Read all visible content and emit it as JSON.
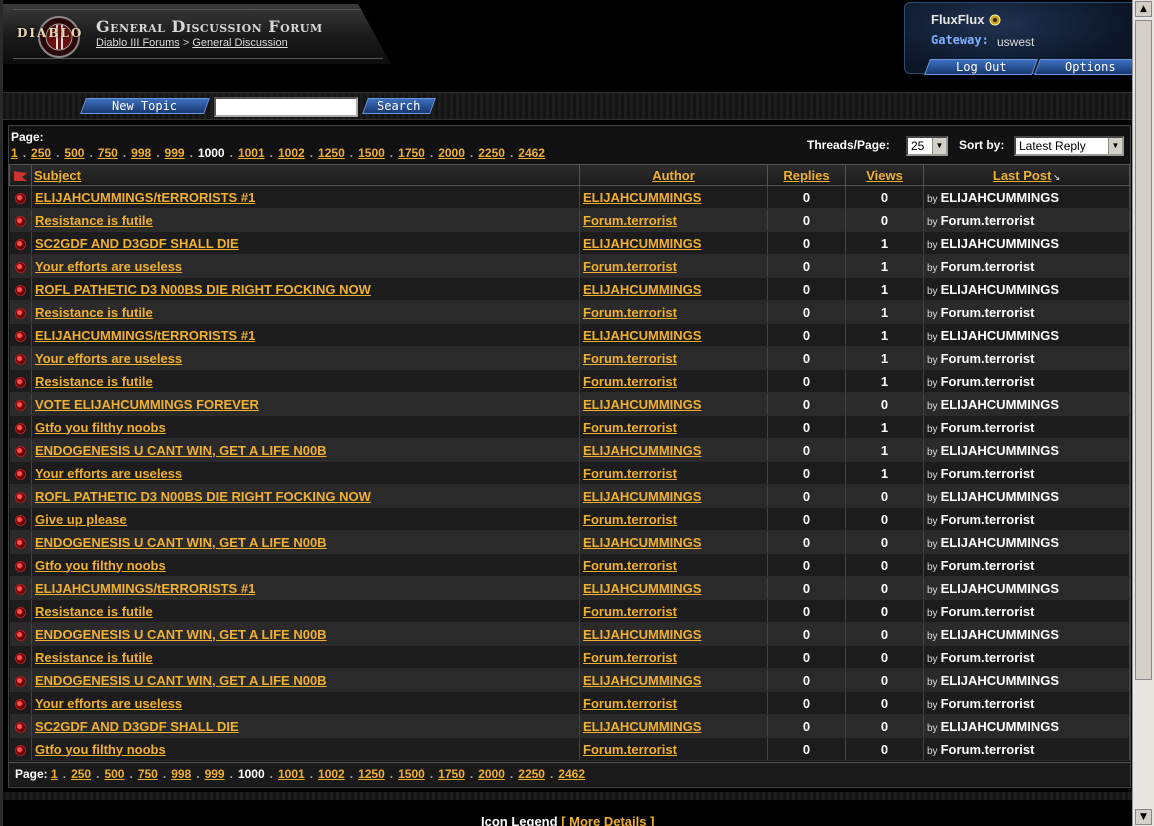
{
  "header": {
    "logo_text": "DIABLO",
    "forum_title": "General Discussion Forum",
    "breadcrumb": {
      "parent": "Diablo III Forums",
      "separator": ">",
      "current": "General Discussion"
    }
  },
  "user": {
    "name": "FluxFlux",
    "gateway_label": "Gateway:",
    "gateway_value": "uswest",
    "logout_label": "Log Out",
    "options_label": "Options"
  },
  "toolbar": {
    "new_topic_label": "New Topic",
    "search_value": "",
    "search_label": "Search"
  },
  "pagination": {
    "label": "Page:",
    "pages": [
      "1",
      "250",
      "500",
      "750",
      "998",
      "999",
      "1000",
      "1001",
      "1002",
      "1250",
      "1500",
      "1750",
      "2000",
      "2250",
      "2462"
    ],
    "current": "1000"
  },
  "controls": {
    "threads_per_page_label": "Threads/Page:",
    "threads_per_page_value": "25",
    "sort_by_label": "Sort by:",
    "sort_by_value": "Latest Reply"
  },
  "table": {
    "columns": {
      "subject": "Subject",
      "author": "Author",
      "replies": "Replies",
      "views": "Views",
      "last_post": "Last Post"
    },
    "by_label": "by",
    "rows": [
      {
        "subject": "ELIJAHCUMMINGS/tERRORISTS #1",
        "author": "ELIJAHCUMMINGS",
        "replies": "0",
        "views": "0",
        "last_by": "ELIJAHCUMMINGS"
      },
      {
        "subject": "Resistance is futile",
        "author": "Forum.terrorist",
        "replies": "0",
        "views": "0",
        "last_by": "Forum.terrorist"
      },
      {
        "subject": "SC2GDF AND D3GDF SHALL DIE",
        "author": "ELIJAHCUMMINGS",
        "replies": "0",
        "views": "1",
        "last_by": "ELIJAHCUMMINGS"
      },
      {
        "subject": "Your efforts are useless",
        "author": "Forum.terrorist",
        "replies": "0",
        "views": "1",
        "last_by": "Forum.terrorist"
      },
      {
        "subject": "ROFL PATHETIC D3 N00BS DIE RIGHT FOCKING NOW",
        "author": "ELIJAHCUMMINGS",
        "replies": "0",
        "views": "1",
        "last_by": "ELIJAHCUMMINGS"
      },
      {
        "subject": "Resistance is futile",
        "author": "Forum.terrorist",
        "replies": "0",
        "views": "1",
        "last_by": "Forum.terrorist"
      },
      {
        "subject": "ELIJAHCUMMINGS/tERRORISTS #1",
        "author": "ELIJAHCUMMINGS",
        "replies": "0",
        "views": "1",
        "last_by": "ELIJAHCUMMINGS"
      },
      {
        "subject": "Your efforts are useless",
        "author": "Forum.terrorist",
        "replies": "0",
        "views": "1",
        "last_by": "Forum.terrorist"
      },
      {
        "subject": "Resistance is futile",
        "author": "Forum.terrorist",
        "replies": "0",
        "views": "1",
        "last_by": "Forum.terrorist"
      },
      {
        "subject": "VOTE ELIJAHCUMMINGS FOREVER",
        "author": "ELIJAHCUMMINGS",
        "replies": "0",
        "views": "0",
        "last_by": "ELIJAHCUMMINGS"
      },
      {
        "subject": "Gtfo you filthy noobs",
        "author": "Forum.terrorist",
        "replies": "0",
        "views": "1",
        "last_by": "Forum.terrorist"
      },
      {
        "subject": "ENDOGENESIS U CANT WIN, GET A LIFE N00B",
        "author": "ELIJAHCUMMINGS",
        "replies": "0",
        "views": "1",
        "last_by": "ELIJAHCUMMINGS"
      },
      {
        "subject": "Your efforts are useless",
        "author": "Forum.terrorist",
        "replies": "0",
        "views": "1",
        "last_by": "Forum.terrorist"
      },
      {
        "subject": "ROFL PATHETIC D3 N00BS DIE RIGHT FOCKING NOW",
        "author": "ELIJAHCUMMINGS",
        "replies": "0",
        "views": "0",
        "last_by": "ELIJAHCUMMINGS"
      },
      {
        "subject": "Give up please",
        "author": "Forum.terrorist",
        "replies": "0",
        "views": "0",
        "last_by": "Forum.terrorist"
      },
      {
        "subject": "ENDOGENESIS U CANT WIN, GET A LIFE N00B",
        "author": "ELIJAHCUMMINGS",
        "replies": "0",
        "views": "0",
        "last_by": "ELIJAHCUMMINGS"
      },
      {
        "subject": "Gtfo you filthy noobs",
        "author": "Forum.terrorist",
        "replies": "0",
        "views": "0",
        "last_by": "Forum.terrorist"
      },
      {
        "subject": "ELIJAHCUMMINGS/tERRORISTS #1",
        "author": "ELIJAHCUMMINGS",
        "replies": "0",
        "views": "0",
        "last_by": "ELIJAHCUMMINGS"
      },
      {
        "subject": "Resistance is futile",
        "author": "Forum.terrorist",
        "replies": "0",
        "views": "0",
        "last_by": "Forum.terrorist"
      },
      {
        "subject": "ENDOGENESIS U CANT WIN, GET A LIFE N00B",
        "author": "ELIJAHCUMMINGS",
        "replies": "0",
        "views": "0",
        "last_by": "ELIJAHCUMMINGS"
      },
      {
        "subject": "Resistance is futile",
        "author": "Forum.terrorist",
        "replies": "0",
        "views": "0",
        "last_by": "Forum.terrorist"
      },
      {
        "subject": "ENDOGENESIS U CANT WIN, GET A LIFE N00B",
        "author": "ELIJAHCUMMINGS",
        "replies": "0",
        "views": "0",
        "last_by": "ELIJAHCUMMINGS"
      },
      {
        "subject": "Your efforts are useless",
        "author": "Forum.terrorist",
        "replies": "0",
        "views": "0",
        "last_by": "Forum.terrorist"
      },
      {
        "subject": "SC2GDF AND D3GDF SHALL DIE",
        "author": "ELIJAHCUMMINGS",
        "replies": "0",
        "views": "0",
        "last_by": "ELIJAHCUMMINGS"
      },
      {
        "subject": "Gtfo you filthy noobs",
        "author": "Forum.terrorist",
        "replies": "0",
        "views": "0",
        "last_by": "Forum.terrorist"
      }
    ]
  },
  "footer": {
    "legend_label": "Icon Legend",
    "more_details_label": "More Details",
    "bracket_open": "[",
    "bracket_close": "]"
  },
  "icons": {
    "thread": "thread-status-icon",
    "flag": "flag-icon",
    "sort": "sort-arrow-icon",
    "user_badge": "user-badge-icon",
    "scroll_up": "scroll-up-icon",
    "scroll_down": "scroll-down-icon"
  },
  "colors": {
    "link": "#f0b030",
    "accent_blue": "#3c6fc0",
    "row_odd": "#1c1c1c",
    "row_even": "#2a2a2a"
  }
}
